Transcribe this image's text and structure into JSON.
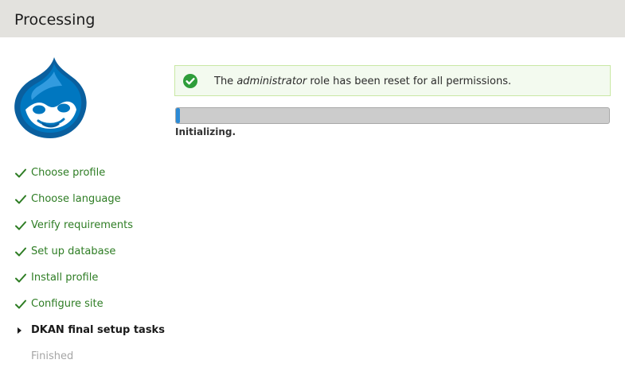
{
  "header": {
    "title": "Processing"
  },
  "logo": {
    "icon": "drupal-drop-icon",
    "color": "#0077c0"
  },
  "message": {
    "icon": "check-circle-icon",
    "text_before": "The ",
    "text_emphasis": "administrator",
    "text_after": " role has been reset for all permissions.",
    "border_color": "#c9e8a4",
    "background_color": "#f3faef"
  },
  "progress": {
    "percent": 1,
    "status": "Initializing.",
    "fill_color": "#2c8ad5"
  },
  "tasks": [
    {
      "label": "Choose profile",
      "state": "done"
    },
    {
      "label": "Choose language",
      "state": "done"
    },
    {
      "label": "Verify requirements",
      "state": "done"
    },
    {
      "label": "Set up database",
      "state": "done"
    },
    {
      "label": "Install profile",
      "state": "done"
    },
    {
      "label": "Configure site",
      "state": "done"
    },
    {
      "label": "DKAN final setup tasks",
      "state": "active"
    },
    {
      "label": "Finished",
      "state": "pending"
    }
  ],
  "colors": {
    "done": "#2e7d24",
    "active": "#1a1a1a",
    "pending": "#a5a5a5"
  }
}
